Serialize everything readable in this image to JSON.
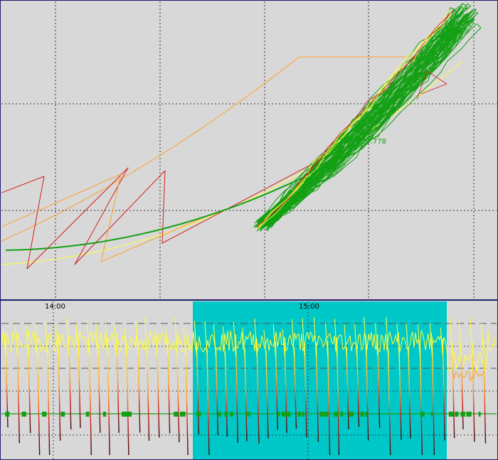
{
  "colors": {
    "background": "#d8d8d8",
    "grid": "#000000",
    "border": "#1e1e6e",
    "highlight": "#00c8c8",
    "green": "#14a014",
    "yellow": "#ffff3c",
    "orange": "#ff9e28",
    "red": "#d21e1e",
    "dark": "#3c0a0a"
  },
  "top_panel": {
    "value_label": "27.778"
  },
  "bottom_panel": {
    "time_labels": [
      "14:00",
      "15:00"
    ]
  },
  "chart_data": [
    {
      "type": "line",
      "title": "",
      "xlabel": "",
      "ylabel": "",
      "grid": true,
      "annotations": [
        "27.778"
      ],
      "series": [
        {
          "color": "green",
          "description_points": [
            [
              0.02,
              0.16
            ],
            [
              0.25,
              0.26
            ],
            [
              0.5,
              0.53
            ],
            [
              0.72,
              0.75
            ],
            [
              0.95,
              0.99
            ]
          ]
        },
        {
          "color": "orange",
          "description_points": [
            [
              0.0,
              0.2
            ],
            [
              0.3,
              0.4
            ],
            [
              0.6,
              0.7
            ],
            [
              0.85,
              0.82
            ]
          ]
        },
        {
          "color": "yellow",
          "description_points": [
            [
              0.0,
              0.12
            ],
            [
              0.4,
              0.2
            ],
            [
              0.8,
              0.64
            ]
          ]
        }
      ]
    },
    {
      "type": "line",
      "title": "",
      "x": [
        "14:00",
        "15:00"
      ],
      "highlight_range": [
        "start-of-cyan-block",
        "end-of-cyan-block"
      ],
      "grid": true,
      "series": [
        {
          "color": "yellow-red gradient",
          "kind": "periodic spikes"
        },
        {
          "color": "green",
          "kind": "baseline"
        }
      ]
    }
  ]
}
